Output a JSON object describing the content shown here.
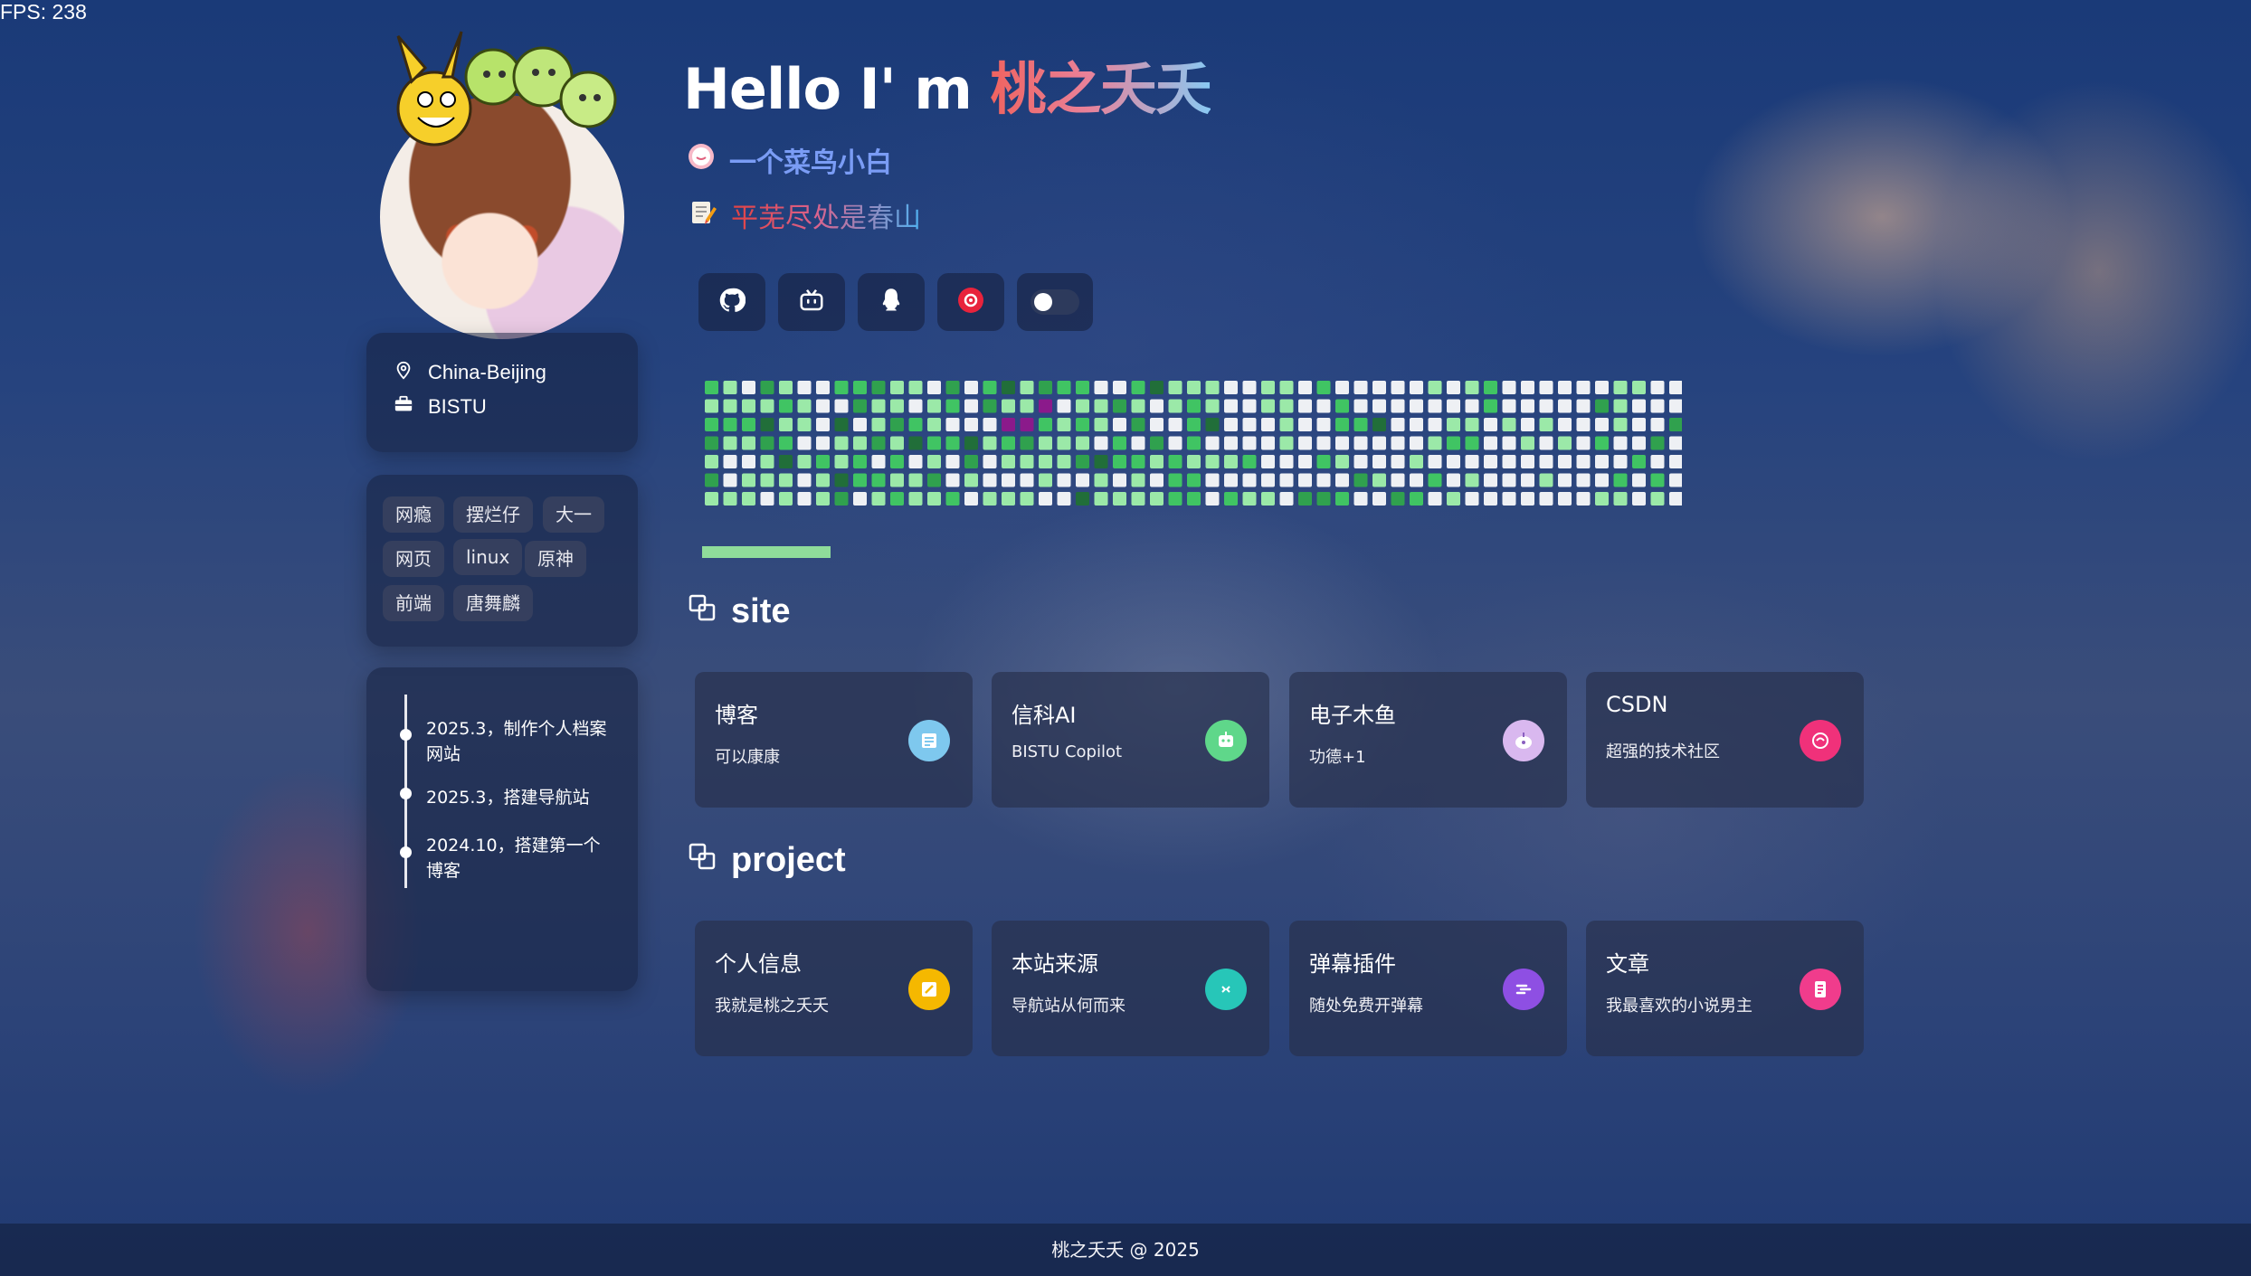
{
  "fps": "FPS: 238",
  "profile": {
    "location": "China-Beijing",
    "school": "BISTU",
    "tags": [
      "网瘾",
      "摆烂仔",
      "大一",
      "网页",
      "linux",
      "原神",
      "前端",
      "唐舞麟"
    ],
    "timeline": [
      "2025.3，制作个人档案网站",
      "2025.3，搭建导航站",
      "2024.10，搭建第一个博客"
    ]
  },
  "hero": {
    "greeting": "Hello I' m ",
    "name": "桃之夭夭",
    "subtitle": "一个菜鸟小白",
    "motto": "平芜尽处是春山"
  },
  "socials": [
    "github-icon",
    "bilibili-icon",
    "qq-icon",
    "netease-music-icon",
    "theme-toggle"
  ],
  "sections": {
    "site": {
      "title": "site",
      "items": [
        {
          "title": "博客",
          "desc": "可以康康",
          "icon": "note-icon",
          "color": "#7ec8ee"
        },
        {
          "title": "信科AI",
          "desc": "BISTU Copilot",
          "icon": "robot-icon",
          "color": "#5fd78a"
        },
        {
          "title": "电子木鱼",
          "desc": "功德+1",
          "icon": "woodfish-icon",
          "color": "#d9b8ef"
        },
        {
          "title": "CSDN",
          "desc": "超强的技术社区",
          "icon": "csdn-icon",
          "color": "#f0317a"
        }
      ]
    },
    "project": {
      "title": "project",
      "items": [
        {
          "title": "个人信息",
          "desc": "我就是桃之夭夭",
          "icon": "profile-icon",
          "color": "#f5b800"
        },
        {
          "title": "本站来源",
          "desc": "导航站从何而来",
          "icon": "source-icon",
          "color": "#27c6b8"
        },
        {
          "title": "弹幕插件",
          "desc": "随处免费开弹幕",
          "icon": "danmaku-icon",
          "color": "#8e4fe3"
        },
        {
          "title": "文章",
          "desc": "我最喜欢的小说男主",
          "icon": "article-icon",
          "color": "#f03c8c"
        }
      ]
    }
  },
  "footer": "桃之夭夭 @ 2025"
}
